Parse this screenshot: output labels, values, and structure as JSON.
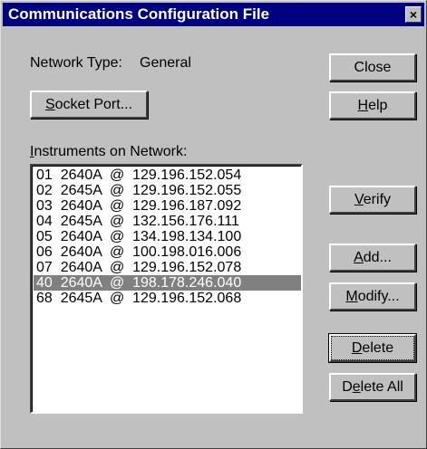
{
  "window": {
    "title": "Communications Configuration File",
    "close_glyph": "×"
  },
  "network_type": {
    "label": "Network Type:",
    "value": "General"
  },
  "buttons": {
    "socket_port": {
      "pre": "",
      "mn": "S",
      "post": "ocket Port..."
    },
    "close": {
      "pre": "Close",
      "mn": "",
      "post": ""
    },
    "help": {
      "pre": "",
      "mn": "H",
      "post": "elp"
    },
    "verify": {
      "pre": "",
      "mn": "V",
      "post": "erify"
    },
    "add": {
      "pre": "",
      "mn": "A",
      "post": "dd..."
    },
    "modify": {
      "pre": "",
      "mn": "M",
      "post": "odify..."
    },
    "delete": {
      "pre": "",
      "mn": "D",
      "post": "elete"
    },
    "delete_all": {
      "pre": "D",
      "mn": "e",
      "post": "lete All"
    }
  },
  "instruments": {
    "label_mn": "I",
    "label_rest": "nstruments on Network:",
    "items": [
      "01  2640A  @  129.196.152.054",
      "02  2645A  @  129.196.152.055",
      "03  2640A  @  129.196.187.092",
      "04  2645A  @  132.156.176.111",
      "05  2640A  @  134.198.134.100",
      "06  2640A  @  100.198.016.006",
      "07  2640A  @  129.196.152.078",
      "40  2640A  @  198.178.246.040",
      "68  2645A  @  129.196.152.068"
    ],
    "selected_index": 7
  },
  "colors": {
    "titlebar": "#000080",
    "face": "#c0c0c0",
    "selection": "#808080"
  }
}
